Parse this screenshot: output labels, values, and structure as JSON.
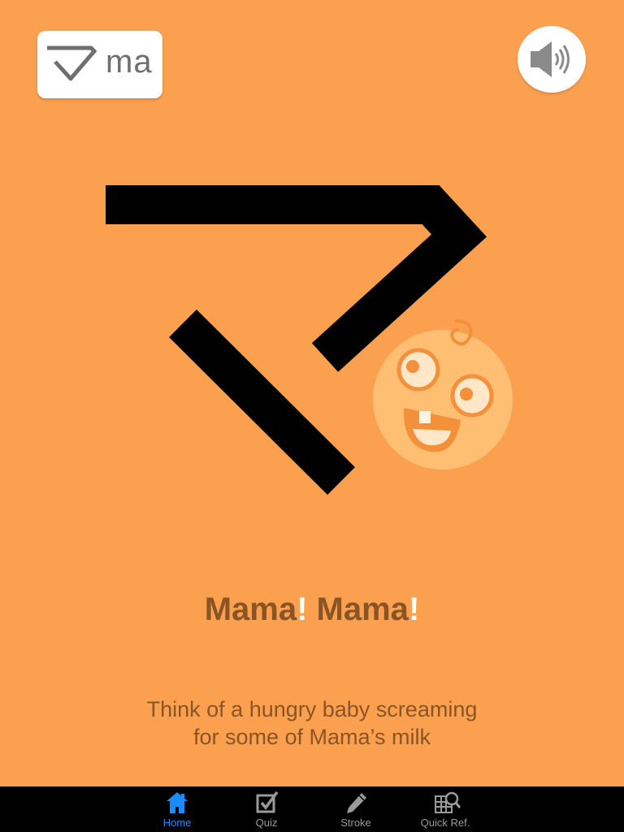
{
  "app": {
    "background_color": "#FBA04F",
    "text_color": "#8B5425",
    "accent_color": "#1a8cff"
  },
  "badge": {
    "romaji": "ma",
    "icon": "katakana-ma-glyph"
  },
  "sound_button": {
    "icon": "speaker-icon"
  },
  "illustration": {
    "character": "マ",
    "mascot": "baby-face"
  },
  "phrase": {
    "part1": "Mama",
    "bang1": "!",
    "part2": " Mama",
    "bang2": "!"
  },
  "description": {
    "line1": "Think of a hungry baby screaming",
    "line2": "for some of Mama’s milk"
  },
  "tabbar": {
    "tabs": [
      {
        "label": "Home",
        "icon": "home-icon",
        "active": true
      },
      {
        "label": "Quiz",
        "icon": "checkbox-icon",
        "active": false
      },
      {
        "label": "Stroke",
        "icon": "pencil-icon",
        "active": false
      },
      {
        "label": "Quick Ref.",
        "icon": "grid-search-icon",
        "active": false
      }
    ]
  }
}
